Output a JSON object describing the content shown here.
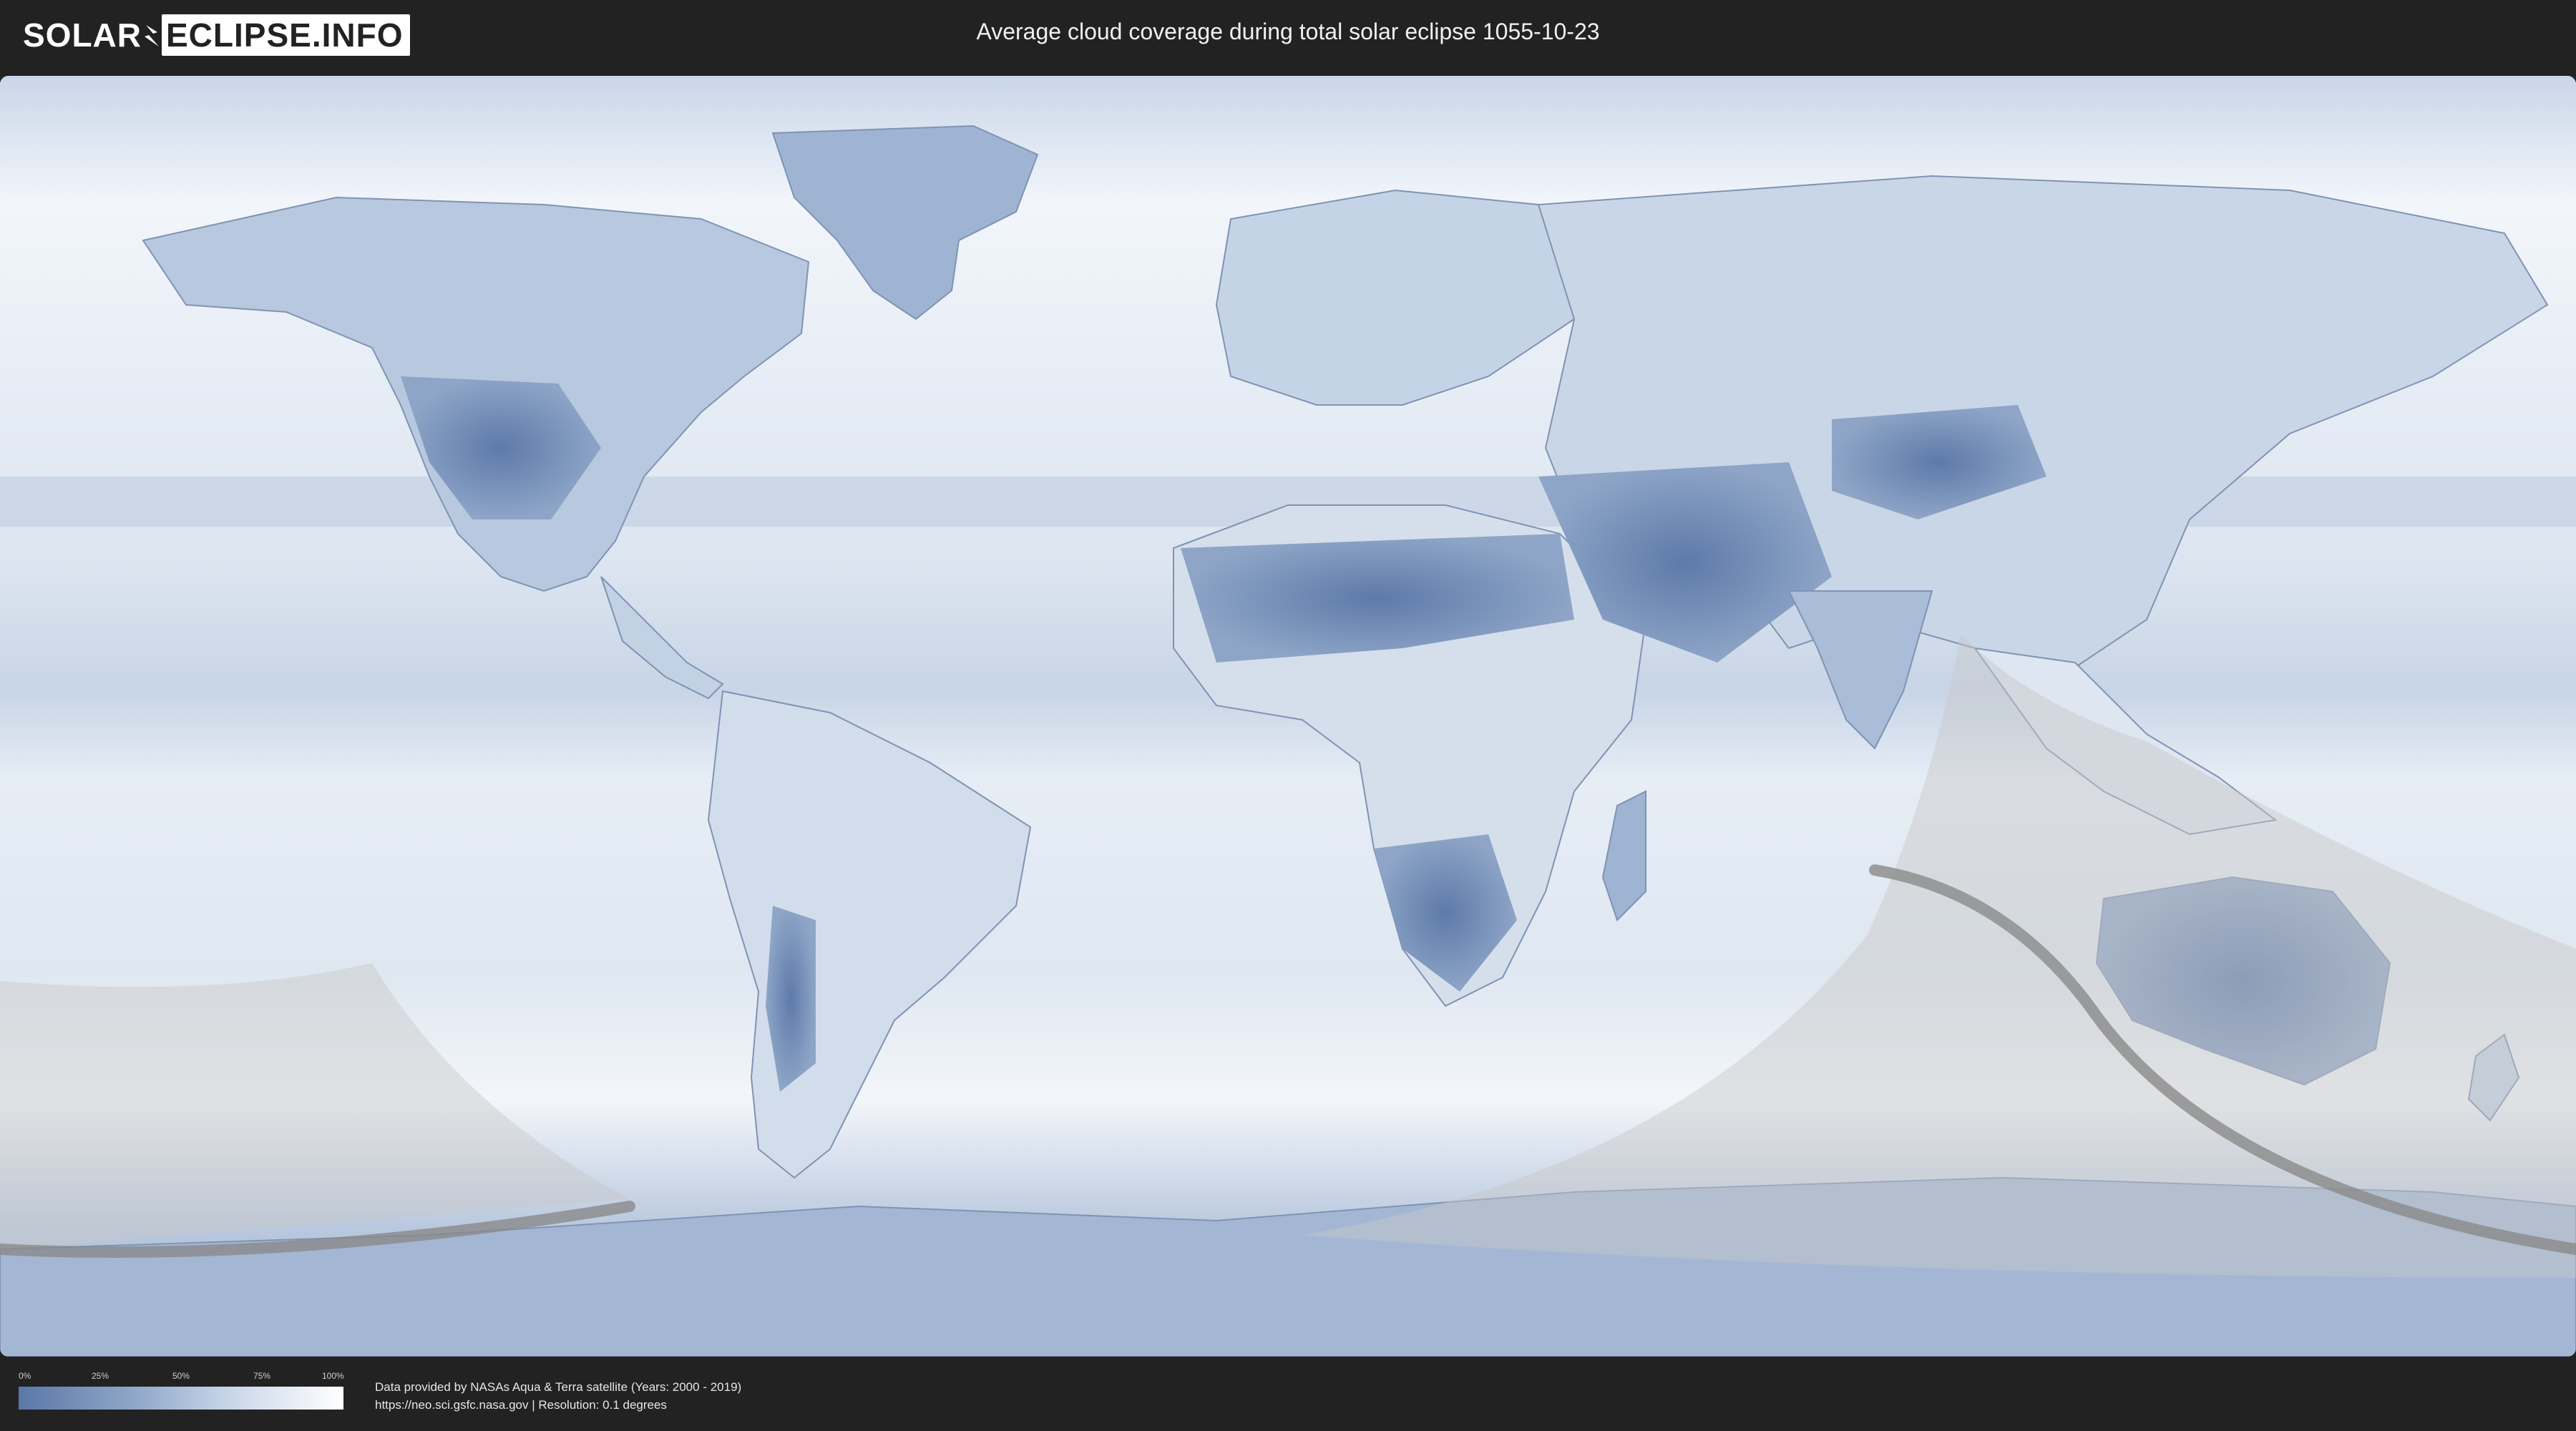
{
  "header": {
    "logo_left": "SOLAR",
    "logo_right": "ECLIPSE.INFO",
    "title": "Average cloud coverage during total solar eclipse 1055-10-23"
  },
  "map": {
    "icon": "world-cloud-coverage-map",
    "colors": {
      "ocean_cloud": "#e4ecf5",
      "clear_sky": "#5b77a6",
      "overcast": "#ffffff",
      "shade": "#c8c8c8",
      "path": "#8a8a8a"
    }
  },
  "legend": {
    "ticks": [
      "0%",
      "25%",
      "50%",
      "75%",
      "100%"
    ]
  },
  "credits": {
    "line1": "Data provided by NASAs Aqua & Terra satellite (Years: 2000 - 2019)",
    "line2": "https://neo.sci.gsfc.nasa.gov | Resolution: 0.1 degrees"
  }
}
